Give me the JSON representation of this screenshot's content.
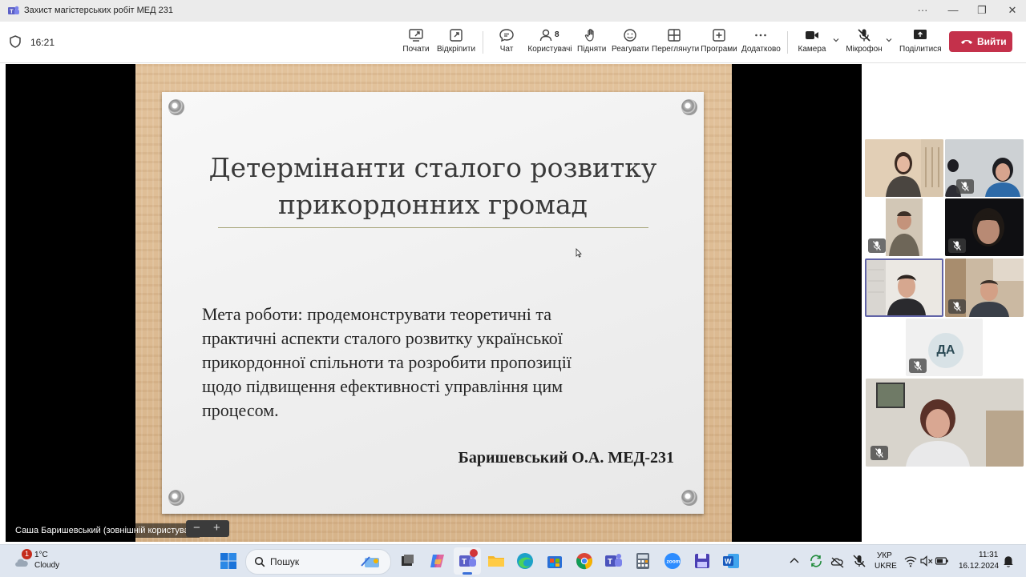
{
  "window": {
    "title": "Захист магістерських робіт МЕД 231",
    "controls": {
      "more": "···",
      "minimize": "—",
      "restore": "❐",
      "close": "✕"
    }
  },
  "toolbar": {
    "timer": "16:21",
    "buttons": {
      "start": "Почати",
      "pop_out": "Відкріпити",
      "chat": "Чат",
      "people": "Користувачі",
      "people_count": "8",
      "raise": "Підняти",
      "react": "Реагувати",
      "view": "Переглянути",
      "apps": "Програми",
      "more": "Додатково",
      "camera": "Камера",
      "mic": "Мікрофон",
      "share": "Поділитися"
    },
    "leave": "Вийти"
  },
  "slide": {
    "title_line1": "Детермінанти сталого розвитку",
    "title_line2": "прикордонних громад",
    "body_line1": "Мета роботи: продемонструвати теоретичні та",
    "body_line2": "практичні аспекти сталого розвитку української",
    "body_line3": "прикордонної спільноти та розробити пропозиції",
    "body_line4": "щодо підвищення ефективності управління цим",
    "body_line5": "процесом.",
    "author": "Баришевський О.А. МЕД-231"
  },
  "presenter": {
    "name": "Саша Баришевський (зовнішній користувач)",
    "zoom_out": "−",
    "zoom_in": "+"
  },
  "participants": {
    "initials_tile": "ДА"
  },
  "taskbar": {
    "weather_badge": "1",
    "temperature": "1°C",
    "condition": "Cloudy",
    "search": "Пошук",
    "language_1": "УКР",
    "language_2": "UKRE",
    "time": "11:31",
    "date": "16.12.2024"
  },
  "colors": {
    "leave_button": "#c4314b",
    "active_speaker_border": "#6264a7",
    "taskbar": "#dfe6f0"
  }
}
